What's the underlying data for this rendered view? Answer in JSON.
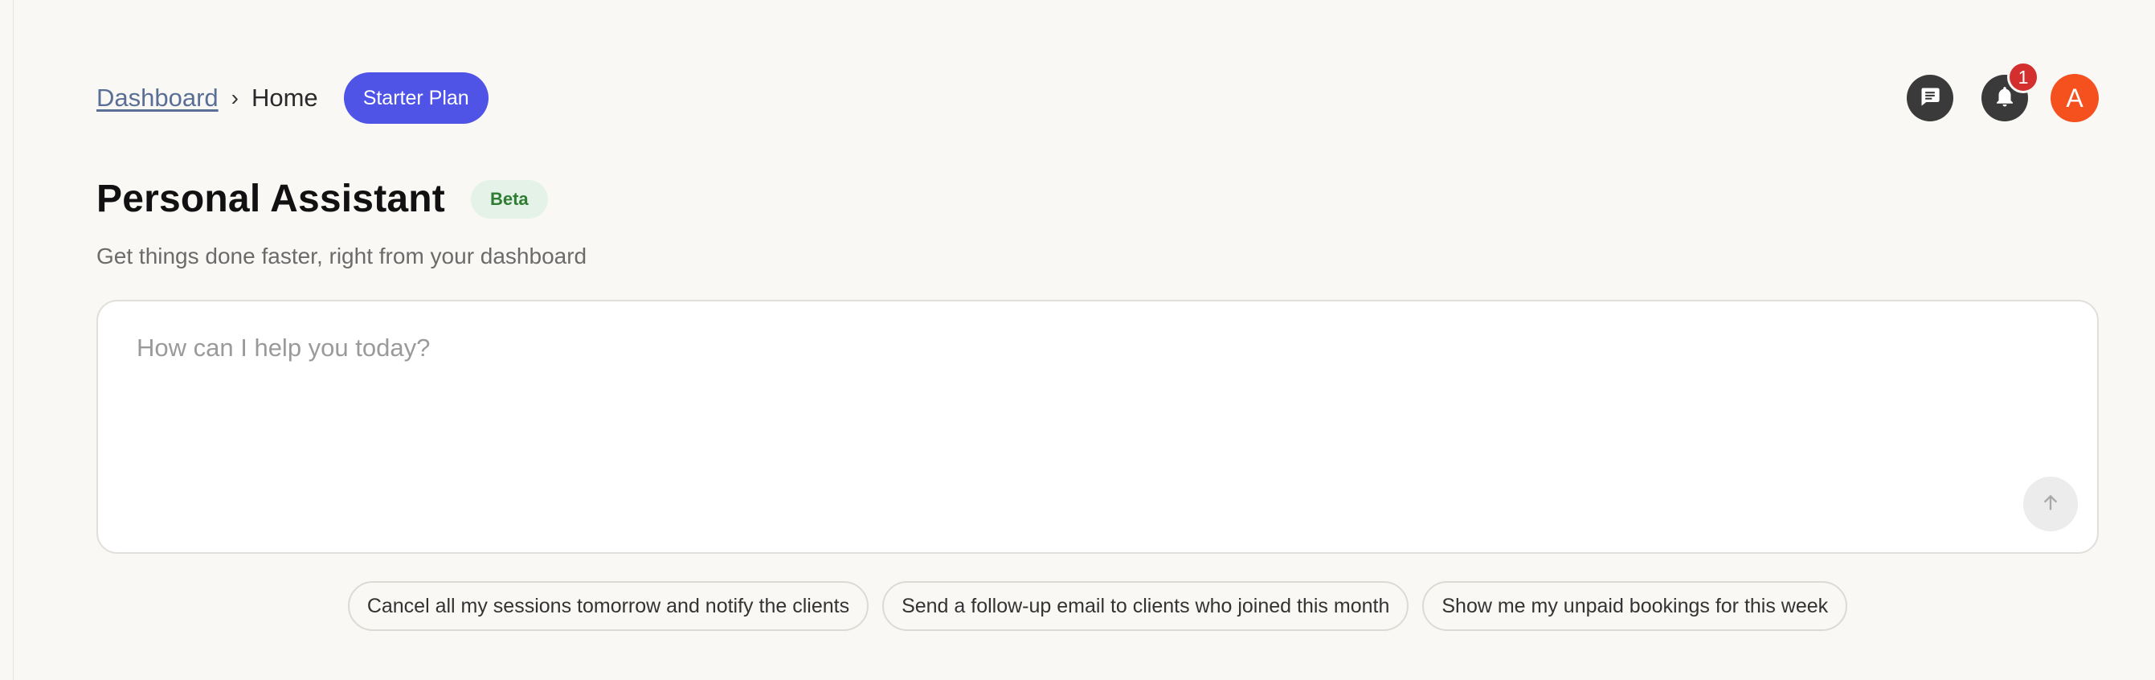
{
  "breadcrumb": {
    "parent": "Dashboard",
    "separator": "›",
    "current": "Home"
  },
  "plan_badge": "Starter Plan",
  "header": {
    "messages_icon": "chat-bubble-icon",
    "notifications_icon": "bell-icon",
    "notification_count": "1",
    "avatar_initial": "A"
  },
  "main": {
    "title": "Personal Assistant",
    "badge": "Beta",
    "subtitle": "Get things done faster, right from your dashboard"
  },
  "prompt": {
    "placeholder": "How can I help you today?",
    "value": "",
    "send_icon": "arrow-up-icon"
  },
  "suggestions": [
    "Cancel all my sessions tomorrow and notify the clients",
    "Send a follow-up email to clients who joined this month",
    "Show me my unpaid bookings for this week"
  ],
  "colors": {
    "background": "#f9f8f5",
    "plan_badge": "#4f53e6",
    "notification_badge": "#d32f2f",
    "avatar": "#f4511e",
    "beta_badge_bg": "#e5f2e7",
    "beta_badge_text": "#2e7d32",
    "icon_button": "#3a3a3a"
  }
}
